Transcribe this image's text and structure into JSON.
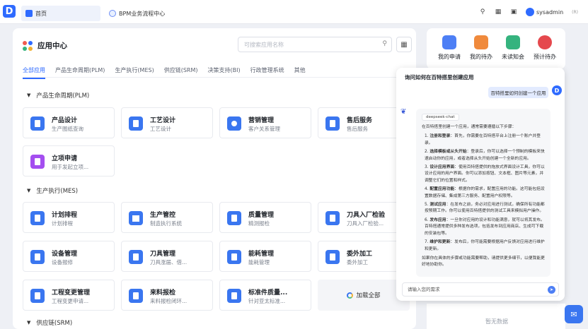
{
  "app": {
    "logo_text": "D"
  },
  "tabs": [
    {
      "label": "首页"
    },
    {
      "label": "BPM业务流程中心"
    }
  ],
  "topbar": {
    "username": "sysadmin",
    "suffix": "(R)"
  },
  "panel": {
    "title": "应用中心",
    "search_placeholder": "可搜索应用名称",
    "categories": [
      "全部应用",
      "产品生命周期(PLM)",
      "生产执行(MES)",
      "供应链(SRM)",
      "决策支持(BI)",
      "行政管理系统",
      "其他"
    ],
    "sections": {
      "plm": "产品生命周期(PLM)",
      "mes": "生产执行(MES)",
      "srm": "供应链(SRM)"
    },
    "plm_cards": [
      {
        "name": "产品设计",
        "desc": "生产图纸查询"
      },
      {
        "name": "工艺设计",
        "desc": "工艺设计"
      },
      {
        "name": "营销管理",
        "desc": "客户关系管理"
      },
      {
        "name": "售后服务",
        "desc": "售后服务"
      },
      {
        "name": "立项申请",
        "desc": "用于发起立项..."
      }
    ],
    "mes_cards": [
      {
        "name": "计划排程",
        "desc": "计划排程"
      },
      {
        "name": "生产管控",
        "desc": "制造执行系统"
      },
      {
        "name": "质量管理",
        "desc": "精测报检"
      },
      {
        "name": "刀具入厂检验",
        "desc": "刀具入厂检验..."
      },
      {
        "name": "设备管理",
        "desc": "设备报修"
      },
      {
        "name": "刀具管理",
        "desc": "刀具涨届、借..."
      },
      {
        "name": "能耗管理",
        "desc": "能耗管理"
      },
      {
        "name": "委外加工",
        "desc": "委外加工"
      },
      {
        "name": "工程变更管理",
        "desc": "工程变更申请..."
      },
      {
        "name": "来料报检",
        "desc": "来料报检闭环..."
      },
      {
        "name": "标准件质量...",
        "desc": "针对亚太标准..."
      }
    ],
    "load_more": "加载全部"
  },
  "widget": {
    "items": [
      {
        "label": "我的申请",
        "color": "#4d7ff5"
      },
      {
        "label": "我的待办",
        "color": "#f08a3c"
      },
      {
        "label": "未读知会",
        "color": "#35b37e"
      },
      {
        "label": "预计待办",
        "color": "#e5484d"
      }
    ]
  },
  "right_bottom": {
    "no_data": "暂无数据"
  },
  "chat": {
    "header": "询问如何在百特搭里创建应用",
    "user_question": "百特搭里如何创建一个应用",
    "user_badge": "D",
    "model_chip": "deepseek-chat",
    "intro": "在百特搭里创建一个应用，通常需要遵循以下步骤：",
    "steps": [
      {
        "title": "注册和登录",
        "text": "：首先，你需要在百特搭平台上注册一个账户并登录。"
      },
      {
        "title": "选择模板或从头开始",
        "text": "：登录后，你可以选择一个预制的模板来快速启动你的应用，或者选择从头开始创建一个全新的应用。"
      },
      {
        "title": "设计应用界面",
        "text": "：使用百特搭提供的拖放式界面设计工具，你可以设计应用的用户界面。你可以添加按钮、文本框、图片等元素，并调整它们的位置和样式。"
      },
      {
        "title": "配置应用功能",
        "text": "：根据你的需求，配置应用的功能。这可能包括设置数据存储、集成第三方服务、配置用户权限等。"
      },
      {
        "title": "测试应用",
        "text": "：在发布之前，务必对应用进行测试，确保所有功能都按预期工作。你可以使用百特搭提供的测试工具来模拟用户操作。"
      },
      {
        "title": "发布应用",
        "text": "：一旦你对应用的设计和功能满意，就可以将其发布。百特搭通常提供多种发布选项，包括发布到应用商店、生成可下载的安装包等。"
      },
      {
        "title": "维护和更新",
        "text": "：发布后，你可能需要根据用户反馈对应用进行维护和更新。"
      }
    ],
    "outro": "如果你在具体的步骤或功能需要帮助，请提供更多细节，以便我能更好地协助你。",
    "input_placeholder": "请输入您的需求"
  }
}
